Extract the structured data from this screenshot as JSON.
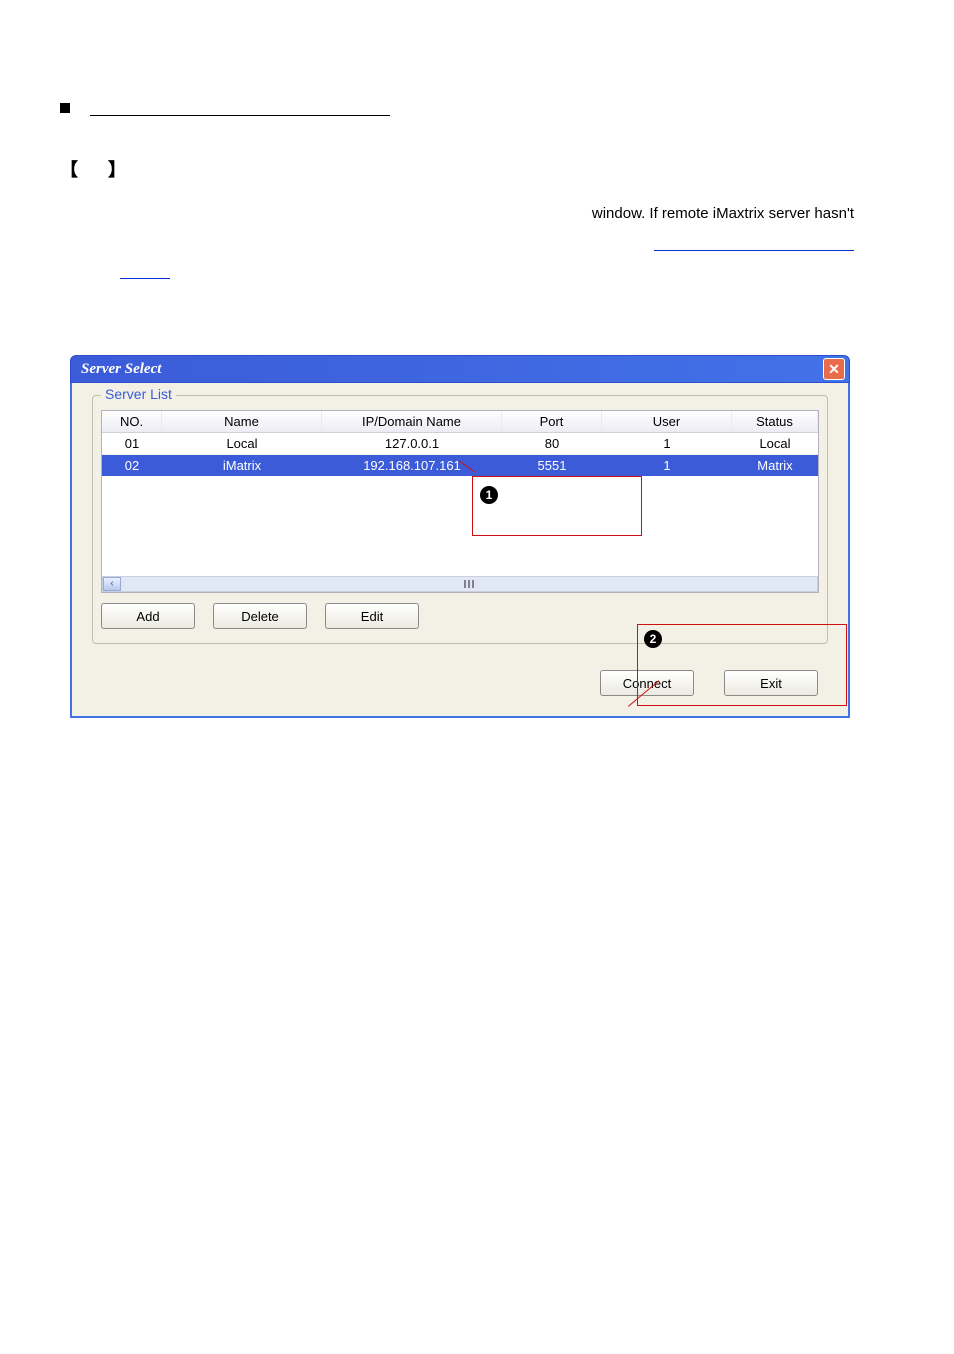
{
  "document": {
    "fragment_right": "window. If remote iMaxtrix server hasn't"
  },
  "dialog": {
    "title": "Server Select",
    "fieldset_legend": "Server List",
    "columns": {
      "no": "NO.",
      "name": "Name",
      "ip": "IP/Domain Name",
      "port": "Port",
      "user": "User",
      "status": "Status"
    },
    "rows": [
      {
        "no": "01",
        "name": "Local",
        "ip": "127.0.0.1",
        "port": "80",
        "user": "1",
        "status": "Local",
        "selected": false
      },
      {
        "no": "02",
        "name": "iMatrix",
        "ip": "192.168.107.161",
        "port": "5551",
        "user": "1",
        "status": "Matrix",
        "selected": true
      }
    ],
    "buttons": {
      "add": "Add",
      "delete": "Delete",
      "edit": "Edit",
      "connect": "Connect",
      "exit": "Exit"
    },
    "callouts": {
      "one": "1",
      "two": "2"
    }
  },
  "chart_data": {
    "type": "table",
    "title": "Server List",
    "columns": [
      "NO.",
      "Name",
      "IP/Domain Name",
      "Port",
      "User",
      "Status"
    ],
    "rows": [
      [
        "01",
        "Local",
        "127.0.0.1",
        "80",
        "1",
        "Local"
      ],
      [
        "02",
        "iMatrix",
        "192.168.107.161",
        "5551",
        "1",
        "Matrix"
      ]
    ]
  }
}
